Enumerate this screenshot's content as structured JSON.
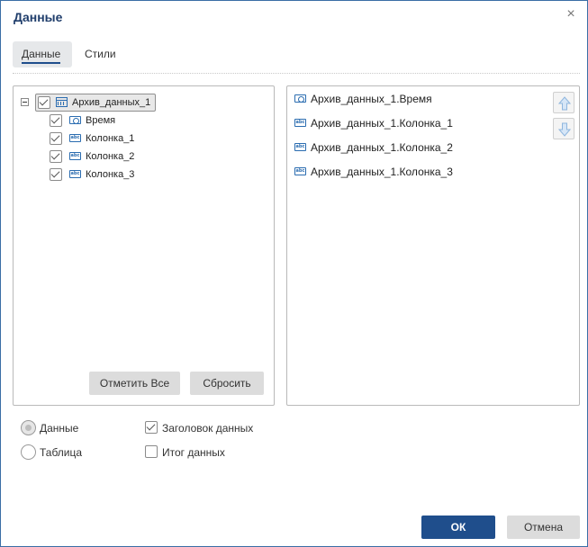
{
  "dialog": {
    "title": "Данные",
    "close_icon": "close-icon"
  },
  "tabs": [
    {
      "label": "Данные",
      "active": true
    },
    {
      "label": "Стили",
      "active": false
    }
  ],
  "tree": {
    "root": {
      "label": "Архив_данных_1",
      "checked": true,
      "expanded": true,
      "icon": "table-icon"
    },
    "children": [
      {
        "label": "Время",
        "checked": true,
        "icon": "clock-icon"
      },
      {
        "label": "Колонка_1",
        "checked": true,
        "icon": "abc-icon"
      },
      {
        "label": "Колонка_2",
        "checked": true,
        "icon": "abc-icon"
      },
      {
        "label": "Колонка_3",
        "checked": true,
        "icon": "abc-icon"
      }
    ],
    "select_all_label": "Отметить Все",
    "reset_label": "Сбросить"
  },
  "selected": {
    "items": [
      {
        "label": "Архив_данных_1.Время",
        "icon": "clock-icon"
      },
      {
        "label": "Архив_данных_1.Колонка_1",
        "icon": "abc-icon"
      },
      {
        "label": "Архив_данных_1.Колонка_2",
        "icon": "abc-icon"
      },
      {
        "label": "Архив_данных_1.Колонка_3",
        "icon": "abc-icon"
      }
    ],
    "move_up_icon": "arrow-up-icon",
    "move_down_icon": "arrow-down-icon"
  },
  "options": {
    "mode": [
      {
        "label": "Данные",
        "selected": true
      },
      {
        "label": "Таблица",
        "selected": false
      }
    ],
    "data_header": {
      "label": "Заголовок данных",
      "checked": true
    },
    "data_total": {
      "label": "Итог данных",
      "checked": false
    }
  },
  "footer": {
    "ok_label": "ОК",
    "cancel_label": "Отмена"
  },
  "colors": {
    "accent": "#1f4e8c",
    "icon_blue": "#2a6cb0",
    "button_gray": "#dcdcdc"
  }
}
